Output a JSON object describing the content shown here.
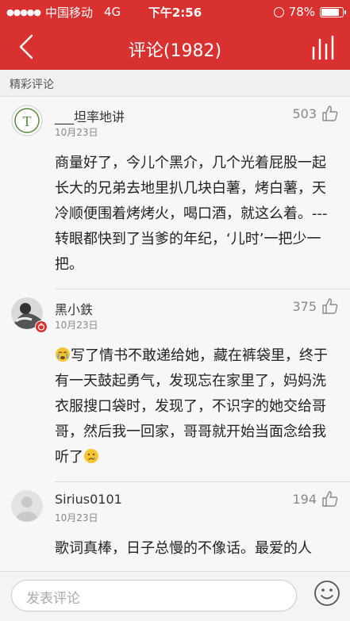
{
  "status_bar": {
    "carrier": "中国移动",
    "network": "4G",
    "time": "下午2:56",
    "battery": "78%"
  },
  "nav": {
    "title": "评论(1982)",
    "back_icon": "chevron-left-icon",
    "chart_icon": "bar-chart-icon"
  },
  "section": {
    "label": "精彩评论"
  },
  "comments": [
    {
      "user": "___坦率地讲",
      "date": "10月23日",
      "likes": "503",
      "text": "商量好了，今儿个黑介，几个光着屁股一起长大的兄弟去地里扒几块白薯，烤白薯，天冷顺便围着烤烤火，喝口酒，就这么着。---转眼都快到了当爹的年纪，‘儿时’一把少一把。"
    },
    {
      "user": "黑小鉄",
      "date": "10月23日",
      "likes": "375",
      "text": "写了情书不敢递给她，藏在裤袋里，终于有一天鼓起勇气，发现忘在家里了，妈妈洗衣服搜口袋时，发现了，不识字的她交给哥哥，然后我一回家，哥哥就开始当面念给我听了"
    },
    {
      "user": "Sirius0101",
      "date": "10月23日",
      "likes": "194",
      "text": "歌词真棒，日子总慢的不像话。最爱的人"
    }
  ],
  "input": {
    "placeholder": "发表评论"
  },
  "colors": {
    "brand": "#d8312f"
  }
}
